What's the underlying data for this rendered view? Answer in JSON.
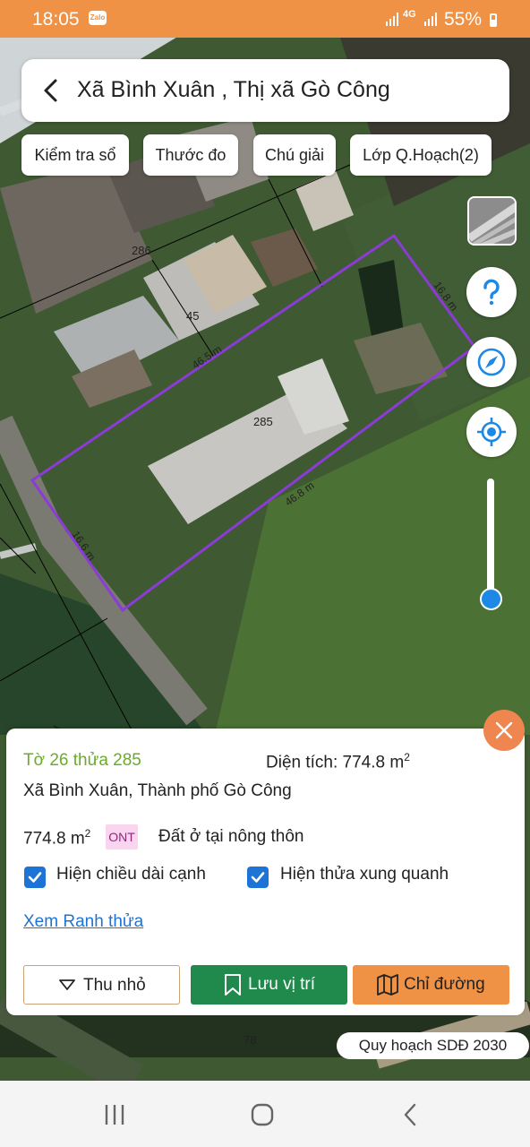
{
  "status_bar": {
    "time": "18:05",
    "app_badge": "Zalo",
    "network": "4G",
    "battery": "55%"
  },
  "header": {
    "title": "Xã Bình Xuân , Thị xã Gò Công"
  },
  "toolbar": {
    "chips": [
      "Kiểm tra sổ",
      "Thước đo",
      "Chú giải",
      "Lớp Q.Hoạch(2)"
    ]
  },
  "map": {
    "parcel_labels": [
      "286",
      "45",
      "285",
      "78"
    ],
    "edge_lengths": [
      "46.5 m",
      "16.8 m",
      "46.8 m",
      "16.6 m"
    ],
    "boundary_color": "#8b3bd6",
    "zoom_level_fraction": 0.05
  },
  "info_panel": {
    "parcel_ref": "Tờ 26 thửa 285",
    "area_label": "Diện tích: 774.8 m",
    "area_sup": "2",
    "address": "Xã Bình Xuân, Thành phố Gò Công",
    "land_area": "774.8 m",
    "land_area_sup": "2",
    "land_code": "ONT",
    "land_type": "Đất ở tại nông thôn",
    "checkbox_edges": {
      "label": "Hiện chiều dài cạnh",
      "checked": true
    },
    "checkbox_neighbors": {
      "label": "Hiện thửa xung quanh",
      "checked": true
    },
    "boundary_link": "Xem Ranh thửa",
    "buttons": {
      "collapse": "Thu nhỏ",
      "save": "Lưu vị trí",
      "directions": "Chỉ đường"
    }
  },
  "plan_label": "Quy hoạch SDĐ 2030",
  "colors": {
    "accent_orange": "#ef9246",
    "save_green": "#1f8a4c",
    "directions_orange": "#ef9246",
    "link_blue": "#1e73d6",
    "parcel_ref_green": "#6aab2c"
  }
}
